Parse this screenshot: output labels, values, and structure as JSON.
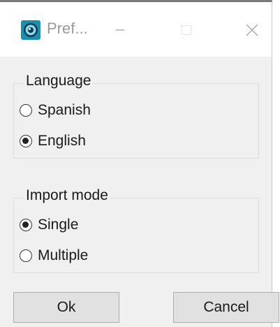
{
  "window": {
    "title": "Pref...",
    "app_icon": "globe-app-icon",
    "controls": {
      "minimize_icon": "minimize-icon",
      "maximize_icon": "maximize-icon",
      "close_icon": "close-icon"
    }
  },
  "language_group": {
    "legend": "Language",
    "options": [
      {
        "label": "Spanish",
        "checked": false
      },
      {
        "label": "English",
        "checked": true
      }
    ]
  },
  "import_group": {
    "legend": "Import mode",
    "options": [
      {
        "label": "Single",
        "checked": true
      },
      {
        "label": "Multiple",
        "checked": false
      }
    ]
  },
  "buttons": {
    "ok_label": "Ok",
    "cancel_label": "Cancel"
  },
  "colors": {
    "dialog_background": "#f0f0f0",
    "titlebar_background": "#ffffff",
    "icon_accent": "#1a8fb0",
    "button_face": "#e1e1e1"
  }
}
